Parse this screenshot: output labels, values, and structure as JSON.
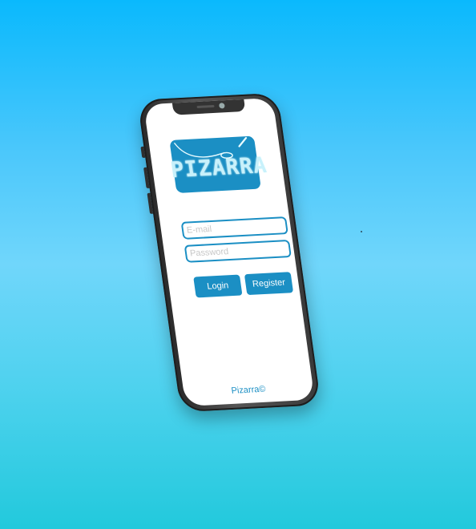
{
  "app": {
    "logo_text": "PIZARRA",
    "footer": "Pizarra©"
  },
  "login_form": {
    "email": {
      "placeholder": "E-mail",
      "value": ""
    },
    "password": {
      "placeholder": "Password",
      "value": ""
    },
    "login_label": "Login",
    "register_label": "Register"
  },
  "colors": {
    "accent": "#1b8fc4",
    "background_top": "#0ab9fd",
    "background_bottom": "#22c9dc",
    "logo_text": "#c8f1fb"
  }
}
